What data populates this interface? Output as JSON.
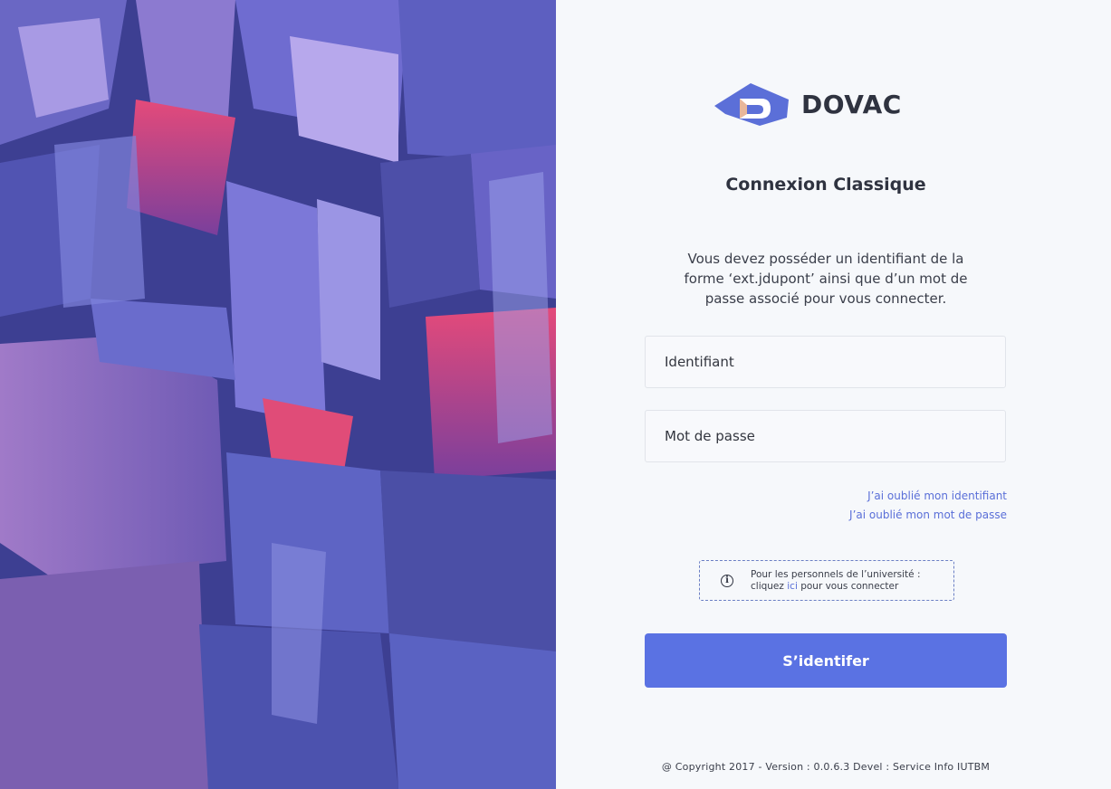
{
  "brand": {
    "name": "DOVAC",
    "logo_icon": "dovac-logo-icon",
    "logo_color": "#5b6fd8"
  },
  "login": {
    "title": "Connexion Classique",
    "description": "Vous devez posséder un identifiant de la forme ‘ext.jdupont’ ainsi que d’un mot de passe associé pour vous connecter.",
    "username_placeholder": "Identifiant",
    "password_placeholder": "Mot de passe",
    "forgot_username": "J’ai oublié mon identifiant",
    "forgot_password": "J’ai oublié mon mot de passe",
    "info_icon": "info-circle-icon",
    "info_line1": "Pour les personnels de l’université :",
    "info_prefix": "cliquez ",
    "info_link": "ici",
    "info_suffix": " pour vous connecter",
    "submit_label": "S’identifer"
  },
  "footer": {
    "copyright": "@ Copyright 2017 - Version : 0.0.6.3 Devel : Service Info IUTBM"
  },
  "colors": {
    "accent": "#5a72e3",
    "link": "#5a6fd8",
    "text": "#2f3340",
    "background": "#f6f8fb"
  }
}
